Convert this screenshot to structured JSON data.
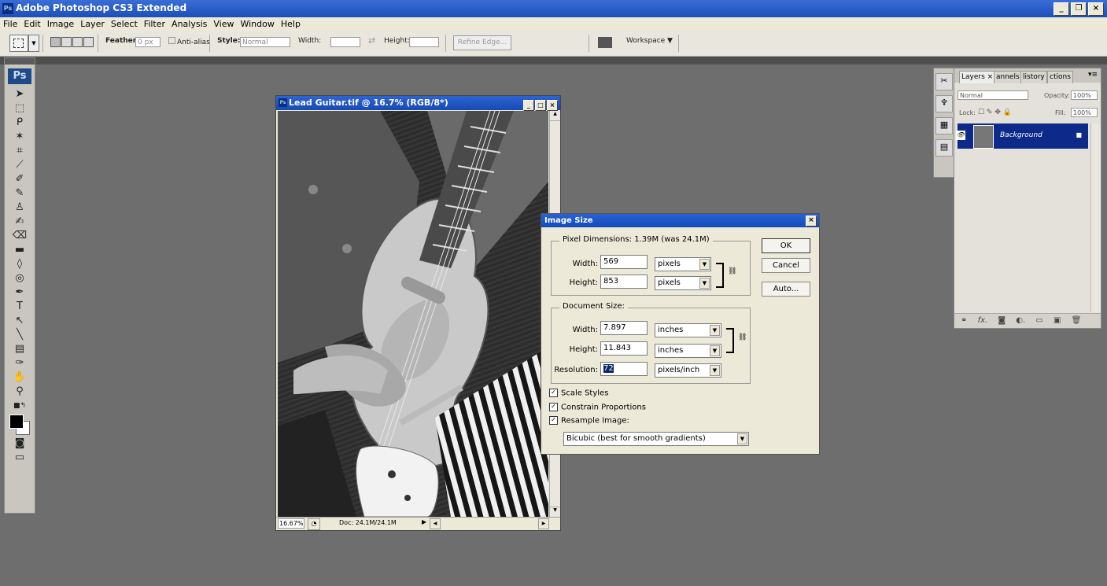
{
  "app": {
    "title": "Adobe Photoshop CS3 Extended",
    "icon_label": "Ps"
  },
  "menu": [
    "File",
    "Edit",
    "Image",
    "Layer",
    "Select",
    "Filter",
    "Analysis",
    "View",
    "Window",
    "Help"
  ],
  "options": {
    "feather_label": "Feather:",
    "feather_value": "0 px",
    "antialias_label": "Anti-alias",
    "style_label": "Style:",
    "style_value": "Normal",
    "width_label": "Width:",
    "height_label": "Height:",
    "refine_edge": "Refine Edge...",
    "workspace": "Workspace ▼"
  },
  "toolbox": {
    "logo": "Ps"
  },
  "document": {
    "title": "Lead Guitar.tif @ 16.7% (RGB/8*)",
    "zoom": "16.67%",
    "doc_size": "Doc: 24.1M/24.1M"
  },
  "dialog": {
    "title": "Image Size",
    "pixel_dimensions": "Pixel Dimensions:  1.39M (was 24.1M)",
    "width_label": "Width:",
    "height_label": "Height:",
    "pixel_width": "569",
    "pixel_height": "853",
    "pixel_unit_w": "pixels",
    "pixel_unit_h": "pixels",
    "document_size": "Document Size:",
    "doc_width": "7.897",
    "doc_height": "11.843",
    "doc_unit_w": "inches",
    "doc_unit_h": "inches",
    "resolution_label": "Resolution:",
    "resolution": "72",
    "resolution_unit": "pixels/inch",
    "ok": "OK",
    "cancel": "Cancel",
    "auto": "Auto...",
    "scale_styles": "Scale Styles",
    "constrain": "Constrain Proportions",
    "resample": "Resample Image:",
    "resample_method": "Bicubic (best for smooth gradients)"
  },
  "layers_panel": {
    "tabs": [
      "Layers ×",
      "annels",
      "listory",
      "ctions"
    ],
    "blend_mode": "Normal",
    "opacity_label": "Opacity:",
    "opacity": "100%",
    "lock_label": "Lock:",
    "fill_label": "Fill:",
    "fill": "100%",
    "layer_name": "Background"
  },
  "colors": {
    "title_blue": "#1c4fb8",
    "workspace_gray": "#6e6e6e",
    "dialog_bg": "#ece9d8",
    "layer_selected": "#0d2a8a"
  }
}
